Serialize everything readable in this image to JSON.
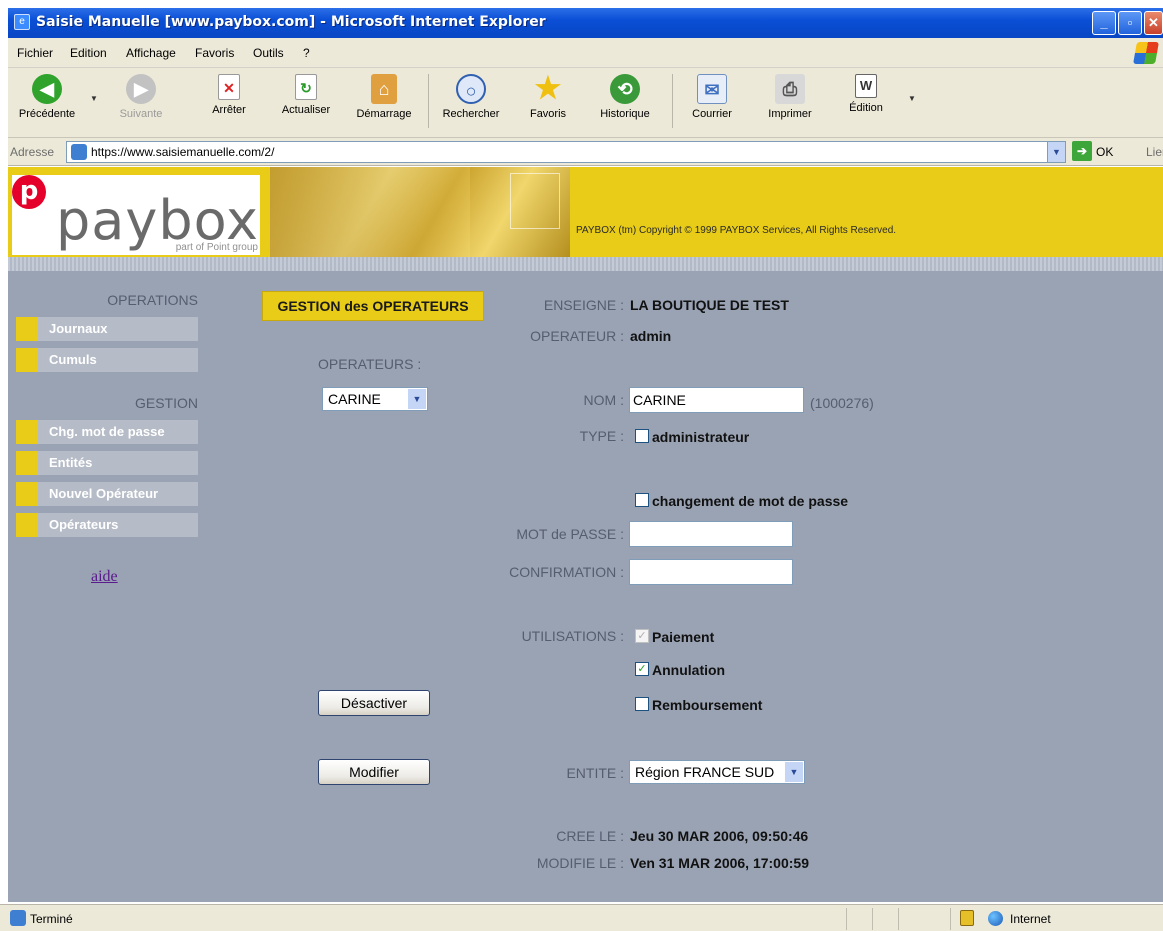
{
  "window": {
    "title": "Saisie Manuelle [www.paybox.com] - Microsoft Internet Explorer"
  },
  "menu": [
    "Fichier",
    "Edition",
    "Affichage",
    "Favoris",
    "Outils",
    "?"
  ],
  "toolbar": {
    "back": "Précédente",
    "forward": "Suivante",
    "stop": "Arrêter",
    "refresh": "Actualiser",
    "home": "Démarrage",
    "search": "Rechercher",
    "favorites": "Favoris",
    "history": "Historique",
    "mail": "Courrier",
    "print": "Imprimer",
    "edit": "Édition"
  },
  "address": {
    "label": "Adresse",
    "url": "https://www.saisiemanuelle.com/2/",
    "go": "OK",
    "links": "Liens"
  },
  "banner": {
    "logo_word": "paybox",
    "logo_letter": "p",
    "logo_sub": "part of Point group",
    "copyright": "PAYBOX (tm) Copyright © 1999 PAYBOX Services, All Rights Reserved."
  },
  "sidebar": {
    "operations_title": "OPERATIONS",
    "operations": [
      "Journaux",
      "Cumuls"
    ],
    "gestion_title": "GESTION",
    "gestion": [
      "Chg. mot de passe",
      "Entités",
      "Nouvel Opérateur",
      "Opérateurs"
    ],
    "help": "aide"
  },
  "main": {
    "section_title": "GESTION des OPERATEURS",
    "operators_label": "OPERATEURS :",
    "operator_selected": "CARINE",
    "enseigne_label": "ENSEIGNE :",
    "enseigne_value": "LA BOUTIQUE DE TEST",
    "operateur_label": "OPERATEUR :",
    "operateur_value": "admin",
    "nom_label": "NOM :",
    "nom_value": "CARINE",
    "nom_id": "(1000276)",
    "type_label": "TYPE :",
    "type_admin": "administrateur",
    "change_pwd": "changement de mot de passe",
    "pwd_label": "MOT de PASSE :",
    "confirm_label": "CONFIRMATION :",
    "usage_label": "UTILISATIONS :",
    "usage_paiement": "Paiement",
    "usage_annulation": "Annulation",
    "usage_remboursement": "Remboursement",
    "deactivate_button": "Désactiver",
    "modify_button": "Modifier",
    "entite_label": "ENTITE :",
    "entite_value": "Région FRANCE SUD",
    "cree_label": "CREE LE :",
    "cree_value": "Jeu 30 MAR 2006, 09:50:46",
    "modifie_label": "MODIFIE LE :",
    "modifie_value": "Ven 31 MAR 2006, 17:00:59"
  },
  "status": {
    "text": "Terminé",
    "zone": "Internet"
  },
  "colors": {
    "brand_yellow": "#e8cc18",
    "page_bg": "#9aa3b4",
    "logo_red": "#e4002b"
  }
}
